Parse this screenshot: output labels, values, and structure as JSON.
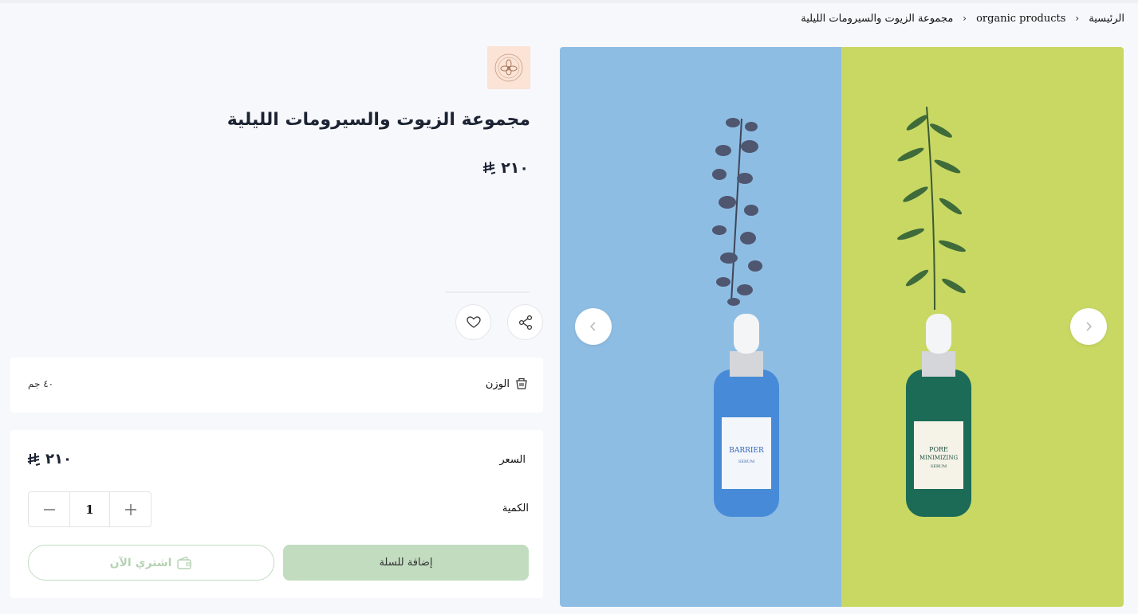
{
  "breadcrumb": {
    "home": "الرئيسية",
    "category": "organic products",
    "current": "مجموعة الزيوت والسيرومات الليلية"
  },
  "product": {
    "title": "مجموعة الزيوت والسيرومات الليلية",
    "price": "٢١٠",
    "currency_icon": "riyal-icon",
    "brand_logo": "flower-logo"
  },
  "attributes": {
    "weight_label": "الوزن",
    "weight_value": "٤٠ جم"
  },
  "purchase": {
    "price_label": "السعر",
    "price_value": "٢١٠",
    "quantity_label": "الكمية",
    "quantity": "1",
    "add_to_cart": "إضافة للسلة",
    "buy_now": "اشتري الآن"
  },
  "gallery": {
    "left_bottle": {
      "line1": "BARRIER",
      "line2": "SERUM"
    },
    "right_bottle": {
      "line1": "PORE",
      "line2": "MINIMIZING",
      "line3": "SERUM"
    }
  },
  "colors": {
    "accent_green": "#c2dcc0",
    "panel_blue": "#8ebde3",
    "panel_lime": "#c8d863",
    "logo_bg": "#fbe3d6"
  }
}
